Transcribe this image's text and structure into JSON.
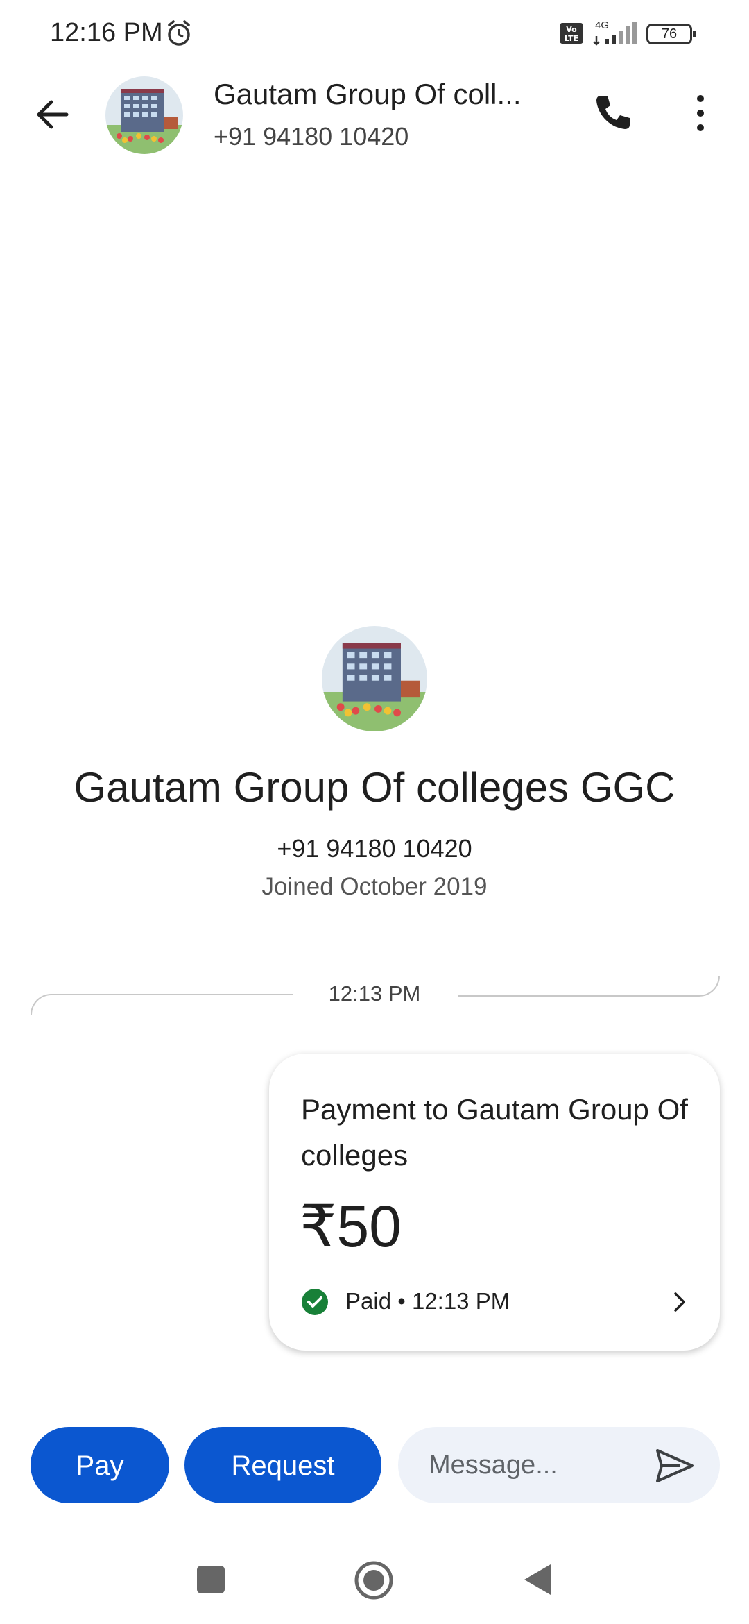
{
  "status_bar": {
    "time": "12:16 PM",
    "network": "4G",
    "battery": "76",
    "icons": [
      "alarm-icon",
      "volte-icon",
      "signal-icon",
      "battery-icon"
    ]
  },
  "header": {
    "title": "Gautam Group Of coll...",
    "phone": "+91 94180 10420",
    "icons": [
      "back-arrow-icon",
      "phone-icon",
      "more-vert-icon"
    ]
  },
  "profile": {
    "name": "Gautam Group Of colleges GGC",
    "phone": "+91 94180 10420",
    "joined": "Joined October 2019"
  },
  "conversation": {
    "timestamp": "12:13 PM",
    "payment_card": {
      "title": "Payment to Gautam Group Of colleges",
      "amount": "₹50",
      "status": "Paid • 12:13 PM",
      "status_color": "#188038"
    }
  },
  "actions": {
    "pay_label": "Pay",
    "request_label": "Request",
    "message_placeholder": "Message...",
    "accent_color": "#0b57d0"
  },
  "nav": {
    "icons": [
      "recents-square-icon",
      "home-circle-icon",
      "back-triangle-icon"
    ]
  }
}
